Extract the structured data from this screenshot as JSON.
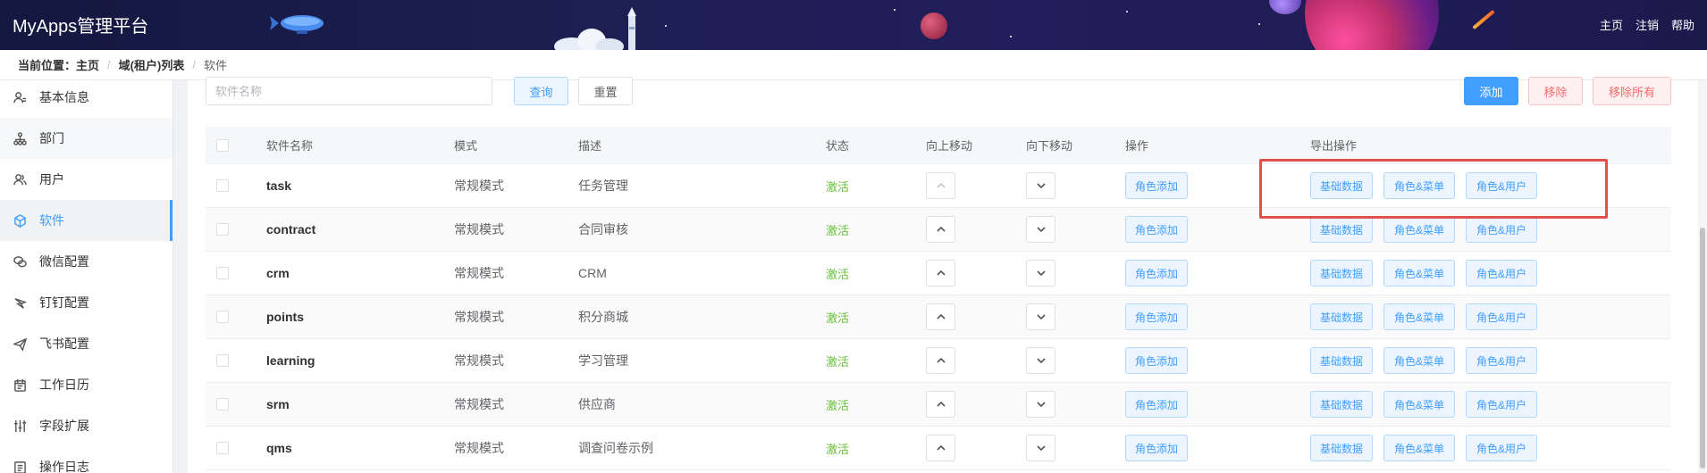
{
  "header": {
    "title": "MyApps管理平台",
    "nav": [
      "主页",
      "注销",
      "帮助"
    ],
    "colors": {
      "bg": "#1b1c4e",
      "planet": "#c0306b"
    }
  },
  "breadcrumb": {
    "prefix": "当前位置：",
    "items": [
      "主页",
      "域(租户)列表",
      "软件"
    ]
  },
  "sidebar": {
    "items": [
      {
        "label": "基本信息",
        "icon": "user-info-icon"
      },
      {
        "label": "部门",
        "icon": "org-chart-icon"
      },
      {
        "label": "用户",
        "icon": "users-icon"
      },
      {
        "label": "软件",
        "icon": "cube-icon",
        "active": true
      },
      {
        "label": "微信配置",
        "icon": "wechat-icon"
      },
      {
        "label": "钉钉配置",
        "icon": "dingtalk-icon"
      },
      {
        "label": "飞书配置",
        "icon": "feishu-icon"
      },
      {
        "label": "工作日历",
        "icon": "calendar-icon"
      },
      {
        "label": "字段扩展",
        "icon": "sliders-icon"
      },
      {
        "label": "操作日志",
        "icon": "log-icon"
      }
    ]
  },
  "toolbar": {
    "search_placeholder": "软件名称",
    "query": "查询",
    "reset": "重置",
    "add": "添加",
    "remove": "移除",
    "remove_all": "移除所有"
  },
  "table": {
    "headers": [
      "软件名称",
      "模式",
      "描述",
      "状态",
      "向上移动",
      "向下移动",
      "操作",
      "导出操作"
    ],
    "op_label": "角色添加",
    "export_labels": [
      "基础数据",
      "角色&菜单",
      "角色&用户"
    ],
    "rows": [
      {
        "name": "task",
        "mode": "常规模式",
        "desc": "任务管理",
        "status": "激活"
      },
      {
        "name": "contract",
        "mode": "常规模式",
        "desc": "合同审核",
        "status": "激活"
      },
      {
        "name": "crm",
        "mode": "常规模式",
        "desc": "CRM",
        "status": "激活"
      },
      {
        "name": "points",
        "mode": "常规模式",
        "desc": "积分商城",
        "status": "激活"
      },
      {
        "name": "learning",
        "mode": "常规模式",
        "desc": "学习管理",
        "status": "激活"
      },
      {
        "name": "srm",
        "mode": "常规模式",
        "desc": "供应商",
        "status": "激活"
      },
      {
        "name": "qms",
        "mode": "常规模式",
        "desc": "调查问卷示例",
        "status": "激活"
      }
    ]
  },
  "colors": {
    "primary": "#409eff",
    "danger": "#f56c6c",
    "success": "#67c23a",
    "highlight": "#e2504c"
  }
}
